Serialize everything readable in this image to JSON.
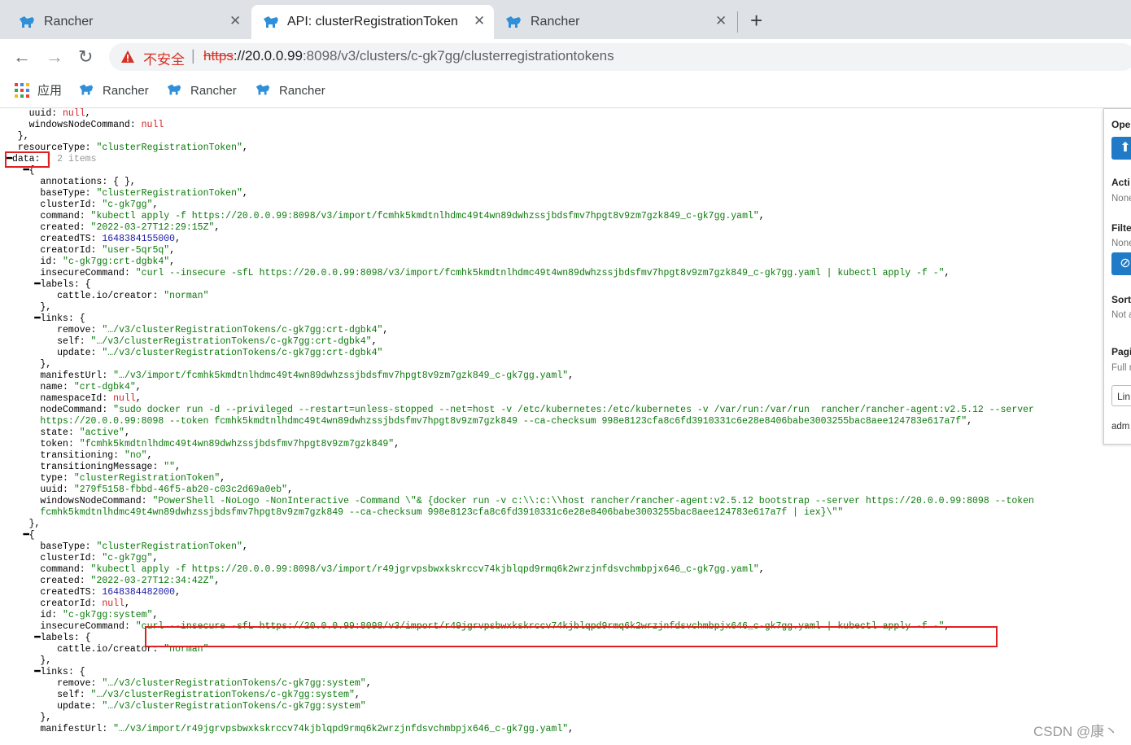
{
  "tabs": [
    {
      "title": "Rancher"
    },
    {
      "title": "API: clusterRegistrationToken"
    },
    {
      "title": "Rancher"
    }
  ],
  "tab_close_glyph": "✕",
  "new_tab_glyph": "+",
  "nav": {
    "back_glyph": "←",
    "forward_glyph": "→",
    "reload_glyph": "↻"
  },
  "address": {
    "security_label": "不安全",
    "separator": "|",
    "scheme": "https",
    "host": "://20.0.0.99",
    "path": ":8098/v3/clusters/c-gk7gg/clusterregistrationtokens"
  },
  "bookmarks": {
    "apps_label": "应用",
    "items": [
      "Rancher",
      "Rancher",
      "Rancher"
    ]
  },
  "colors": {
    "string": "#0b7a0b",
    "number": "#1a1aa6",
    "null": "#d32020",
    "highlight": "#e02020",
    "rancher_blue": "#2f8fd8"
  },
  "icons": [
    "rancher-favicon",
    "close-icon",
    "plus-icon",
    "back-arrow-icon",
    "forward-arrow-icon",
    "reload-icon",
    "warning-icon",
    "apps-grid-icon",
    "up-arrow-icon",
    "clear-filter-icon"
  ],
  "json_lines": [
    [
      [
        "    ",
        "p"
      ],
      [
        "uuid",
        "k"
      ],
      [
        ": ",
        "p"
      ],
      [
        "null",
        "nl"
      ],
      [
        ",",
        "p"
      ]
    ],
    [
      [
        "    ",
        "p"
      ],
      [
        "windowsNodeCommand",
        "k"
      ],
      [
        ": ",
        "p"
      ],
      [
        "null",
        "nl"
      ]
    ],
    [
      [
        "  },",
        "p"
      ]
    ],
    [
      [
        "  ",
        "p"
      ],
      [
        "resourceType",
        "k"
      ],
      [
        ": ",
        "p"
      ],
      [
        "\"clusterRegistrationToken\"",
        "s"
      ],
      [
        ",",
        "p"
      ]
    ],
    [
      [
        "━",
        "t"
      ],
      [
        "data",
        "k"
      ],
      [
        ": ",
        "p"
      ],
      [
        "[ 2 items",
        "g"
      ]
    ],
    [
      [
        "   ━",
        "t"
      ],
      [
        "{",
        "p"
      ]
    ],
    [
      [
        "      ",
        "p"
      ],
      [
        "annotations",
        "k"
      ],
      [
        ": { },",
        "p"
      ]
    ],
    [
      [
        "      ",
        "p"
      ],
      [
        "baseType",
        "k"
      ],
      [
        ": ",
        "p"
      ],
      [
        "\"clusterRegistrationToken\"",
        "s"
      ],
      [
        ",",
        "p"
      ]
    ],
    [
      [
        "      ",
        "p"
      ],
      [
        "clusterId",
        "k"
      ],
      [
        ": ",
        "p"
      ],
      [
        "\"c-gk7gg\"",
        "s"
      ],
      [
        ",",
        "p"
      ]
    ],
    [
      [
        "      ",
        "p"
      ],
      [
        "command",
        "k"
      ],
      [
        ": ",
        "p"
      ],
      [
        "\"kubectl apply -f https://20.0.0.99:8098/v3/import/fcmhk5kmdtnlhdmc49t4wn89dwhzssjbdsfmv7hpgt8v9zm7gzk849_c-gk7gg.yaml\"",
        "s"
      ],
      [
        ",",
        "p"
      ]
    ],
    [
      [
        "      ",
        "p"
      ],
      [
        "created",
        "k"
      ],
      [
        ": ",
        "p"
      ],
      [
        "\"2022-03-27T12:29:15Z\"",
        "s"
      ],
      [
        ",",
        "p"
      ]
    ],
    [
      [
        "      ",
        "p"
      ],
      [
        "createdTS",
        "k"
      ],
      [
        ": ",
        "p"
      ],
      [
        "1648384155000",
        "n"
      ],
      [
        ",",
        "p"
      ]
    ],
    [
      [
        "      ",
        "p"
      ],
      [
        "creatorId",
        "k"
      ],
      [
        ": ",
        "p"
      ],
      [
        "\"user-5qr5q\"",
        "s"
      ],
      [
        ",",
        "p"
      ]
    ],
    [
      [
        "      ",
        "p"
      ],
      [
        "id",
        "k"
      ],
      [
        ": ",
        "p"
      ],
      [
        "\"c-gk7gg:crt-dgbk4\"",
        "s"
      ],
      [
        ",",
        "p"
      ]
    ],
    [
      [
        "      ",
        "p"
      ],
      [
        "insecureCommand",
        "k"
      ],
      [
        ": ",
        "p"
      ],
      [
        "\"curl --insecure -sfL https://20.0.0.99:8098/v3/import/fcmhk5kmdtnlhdmc49t4wn89dwhzssjbdsfmv7hpgt8v9zm7gzk849_c-gk7gg.yaml | kubectl apply -f -\"",
        "s"
      ],
      [
        ",",
        "p"
      ]
    ],
    [
      [
        "     ━",
        "t"
      ],
      [
        "labels",
        "k"
      ],
      [
        ": {",
        "p"
      ]
    ],
    [
      [
        "         ",
        "p"
      ],
      [
        "cattle.io/creator",
        "k"
      ],
      [
        ": ",
        "p"
      ],
      [
        "\"norman\"",
        "s"
      ]
    ],
    [
      [
        "      },",
        "p"
      ]
    ],
    [
      [
        "     ━",
        "t"
      ],
      [
        "links",
        "k"
      ],
      [
        ": {",
        "p"
      ]
    ],
    [
      [
        "         ",
        "p"
      ],
      [
        "remove",
        "k"
      ],
      [
        ": ",
        "p"
      ],
      [
        "\"…/v3/clusterRegistrationTokens/c-gk7gg:crt-dgbk4\"",
        "s"
      ],
      [
        ",",
        "p"
      ]
    ],
    [
      [
        "         ",
        "p"
      ],
      [
        "self",
        "k"
      ],
      [
        ": ",
        "p"
      ],
      [
        "\"…/v3/clusterRegistrationTokens/c-gk7gg:crt-dgbk4\"",
        "s"
      ],
      [
        ",",
        "p"
      ]
    ],
    [
      [
        "         ",
        "p"
      ],
      [
        "update",
        "k"
      ],
      [
        ": ",
        "p"
      ],
      [
        "\"…/v3/clusterRegistrationTokens/c-gk7gg:crt-dgbk4\"",
        "s"
      ]
    ],
    [
      [
        "      },",
        "p"
      ]
    ],
    [
      [
        "      ",
        "p"
      ],
      [
        "manifestUrl",
        "k"
      ],
      [
        ": ",
        "p"
      ],
      [
        "\"…/v3/import/fcmhk5kmdtnlhdmc49t4wn89dwhzssjbdsfmv7hpgt8v9zm7gzk849_c-gk7gg.yaml\"",
        "s"
      ],
      [
        ",",
        "p"
      ]
    ],
    [
      [
        "      ",
        "p"
      ],
      [
        "name",
        "k"
      ],
      [
        ": ",
        "p"
      ],
      [
        "\"crt-dgbk4\"",
        "s"
      ],
      [
        ",",
        "p"
      ]
    ],
    [
      [
        "      ",
        "p"
      ],
      [
        "namespaceId",
        "k"
      ],
      [
        ": ",
        "p"
      ],
      [
        "null",
        "nl"
      ],
      [
        ",",
        "p"
      ]
    ],
    [
      [
        "      ",
        "p"
      ],
      [
        "nodeCommand",
        "k"
      ],
      [
        ": ",
        "p"
      ],
      [
        "\"sudo docker run -d --privileged --restart=unless-stopped --net=host -v /etc/kubernetes:/etc/kubernetes -v /var/run:/var/run  rancher/rancher-agent:v2.5.12 --server",
        "s"
      ]
    ],
    [
      [
        "      ",
        "p"
      ],
      [
        "https://20.0.0.99:8098 --token fcmhk5kmdtnlhdmc49t4wn89dwhzssjbdsfmv7hpgt8v9zm7gzk849 --ca-checksum 998e8123cfa8c6fd3910331c6e28e8406babe3003255bac8aee124783e617a7f\"",
        "s"
      ],
      [
        ",",
        "p"
      ]
    ],
    [
      [
        "      ",
        "p"
      ],
      [
        "state",
        "k"
      ],
      [
        ": ",
        "p"
      ],
      [
        "\"active\"",
        "s"
      ],
      [
        ",",
        "p"
      ]
    ],
    [
      [
        "      ",
        "p"
      ],
      [
        "token",
        "k"
      ],
      [
        ": ",
        "p"
      ],
      [
        "\"fcmhk5kmdtnlhdmc49t4wn89dwhzssjbdsfmv7hpgt8v9zm7gzk849\"",
        "s"
      ],
      [
        ",",
        "p"
      ]
    ],
    [
      [
        "      ",
        "p"
      ],
      [
        "transitioning",
        "k"
      ],
      [
        ": ",
        "p"
      ],
      [
        "\"no\"",
        "s"
      ],
      [
        ",",
        "p"
      ]
    ],
    [
      [
        "      ",
        "p"
      ],
      [
        "transitioningMessage",
        "k"
      ],
      [
        ": ",
        "p"
      ],
      [
        "\"\"",
        "s"
      ],
      [
        ",",
        "p"
      ]
    ],
    [
      [
        "      ",
        "p"
      ],
      [
        "type",
        "k"
      ],
      [
        ": ",
        "p"
      ],
      [
        "\"clusterRegistrationToken\"",
        "s"
      ],
      [
        ",",
        "p"
      ]
    ],
    [
      [
        "      ",
        "p"
      ],
      [
        "uuid",
        "k"
      ],
      [
        ": ",
        "p"
      ],
      [
        "\"279f5158-fbbd-46f5-ab20-c03c2d69a0eb\"",
        "s"
      ],
      [
        ",",
        "p"
      ]
    ],
    [
      [
        "      ",
        "p"
      ],
      [
        "windowsNodeCommand",
        "k"
      ],
      [
        ": ",
        "p"
      ],
      [
        "\"PowerShell -NoLogo -NonInteractive -Command \\\"& {docker run -v c:\\\\:c:\\\\host rancher/rancher-agent:v2.5.12 bootstrap --server https://20.0.0.99:8098 --token",
        "s"
      ]
    ],
    [
      [
        "      ",
        "p"
      ],
      [
        "fcmhk5kmdtnlhdmc49t4wn89dwhzssjbdsfmv7hpgt8v9zm7gzk849 --ca-checksum 998e8123cfa8c6fd3910331c6e28e8406babe3003255bac8aee124783e617a7f | iex}\\\"\"",
        "s"
      ]
    ],
    [
      [
        "    },",
        "p"
      ]
    ],
    [
      [
        "   ━",
        "t"
      ],
      [
        "{",
        "p"
      ]
    ],
    [
      [
        "      ",
        "p"
      ],
      [
        "baseType",
        "k"
      ],
      [
        ": ",
        "p"
      ],
      [
        "\"clusterRegistrationToken\"",
        "s"
      ],
      [
        ",",
        "p"
      ]
    ],
    [
      [
        "      ",
        "p"
      ],
      [
        "clusterId",
        "k"
      ],
      [
        ": ",
        "p"
      ],
      [
        "\"c-gk7gg\"",
        "s"
      ],
      [
        ",",
        "p"
      ]
    ],
    [
      [
        "      ",
        "p"
      ],
      [
        "command",
        "k"
      ],
      [
        ": ",
        "p"
      ],
      [
        "\"kubectl apply -f https://20.0.0.99:8098/v3/import/r49jgrvpsbwxkskrccv74kjblqpd9rmq6k2wrzjnfdsvchmbpjx646_c-gk7gg.yaml\"",
        "s"
      ],
      [
        ",",
        "p"
      ]
    ],
    [
      [
        "      ",
        "p"
      ],
      [
        "created",
        "k"
      ],
      [
        ": ",
        "p"
      ],
      [
        "\"2022-03-27T12:34:42Z\"",
        "s"
      ],
      [
        ",",
        "p"
      ]
    ],
    [
      [
        "      ",
        "p"
      ],
      [
        "createdTS",
        "k"
      ],
      [
        ": ",
        "p"
      ],
      [
        "1648384482000",
        "n"
      ],
      [
        ",",
        "p"
      ]
    ],
    [
      [
        "      ",
        "p"
      ],
      [
        "creatorId",
        "k"
      ],
      [
        ": ",
        "p"
      ],
      [
        "null",
        "nl"
      ],
      [
        ",",
        "p"
      ]
    ],
    [
      [
        "      ",
        "p"
      ],
      [
        "id",
        "k"
      ],
      [
        ": ",
        "p"
      ],
      [
        "\"c-gk7gg:system\"",
        "s"
      ],
      [
        ",",
        "p"
      ]
    ],
    [
      [
        "      ",
        "p"
      ],
      [
        "insecureCommand",
        "k"
      ],
      [
        ": ",
        "p"
      ],
      [
        "\"curl --insecure -sfL https://20.0.0.99:8098/v3/import/r49jgrvpsbwxkskrccv74kjblqpd9rmq6k2wrzjnfdsvchmbpjx646_c-gk7gg.yaml | kubectl apply -f -\"",
        "s"
      ],
      [
        ",",
        "p"
      ]
    ],
    [
      [
        "     ━",
        "t"
      ],
      [
        "labels",
        "k"
      ],
      [
        ": {",
        "p"
      ]
    ],
    [
      [
        "         ",
        "p"
      ],
      [
        "cattle.io/creator",
        "k"
      ],
      [
        ": ",
        "p"
      ],
      [
        "\"norman\"",
        "s"
      ]
    ],
    [
      [
        "      },",
        "p"
      ]
    ],
    [
      [
        "     ━",
        "t"
      ],
      [
        "links",
        "k"
      ],
      [
        ": {",
        "p"
      ]
    ],
    [
      [
        "         ",
        "p"
      ],
      [
        "remove",
        "k"
      ],
      [
        ": ",
        "p"
      ],
      [
        "\"…/v3/clusterRegistrationTokens/c-gk7gg:system\"",
        "s"
      ],
      [
        ",",
        "p"
      ]
    ],
    [
      [
        "         ",
        "p"
      ],
      [
        "self",
        "k"
      ],
      [
        ": ",
        "p"
      ],
      [
        "\"…/v3/clusterRegistrationTokens/c-gk7gg:system\"",
        "s"
      ],
      [
        ",",
        "p"
      ]
    ],
    [
      [
        "         ",
        "p"
      ],
      [
        "update",
        "k"
      ],
      [
        ": ",
        "p"
      ],
      [
        "\"…/v3/clusterRegistrationTokens/c-gk7gg:system\"",
        "s"
      ]
    ],
    [
      [
        "      },",
        "p"
      ]
    ],
    [
      [
        "      ",
        "p"
      ],
      [
        "manifestUrl",
        "k"
      ],
      [
        ": ",
        "p"
      ],
      [
        "\"…/v3/import/r49jgrvpsbwxkskrccv74kjblqpd9rmq6k2wrzjnfdsvchmbpjx646_c-gk7gg.yaml\"",
        "s"
      ],
      [
        ",",
        "p"
      ]
    ]
  ],
  "panel": {
    "sections": [
      {
        "heading": "Ope",
        "text": ""
      },
      {
        "heading": "Acti",
        "text": "None"
      },
      {
        "heading": "Filte",
        "text": "None"
      },
      {
        "heading": "Sort",
        "text": "Not a"
      },
      {
        "heading": "Pagi",
        "text": "Full r"
      }
    ],
    "up_button": "⬆",
    "clear_button": "⊘",
    "link_button": "Lin",
    "footer": "adm"
  },
  "watermark": "CSDN @康丶"
}
